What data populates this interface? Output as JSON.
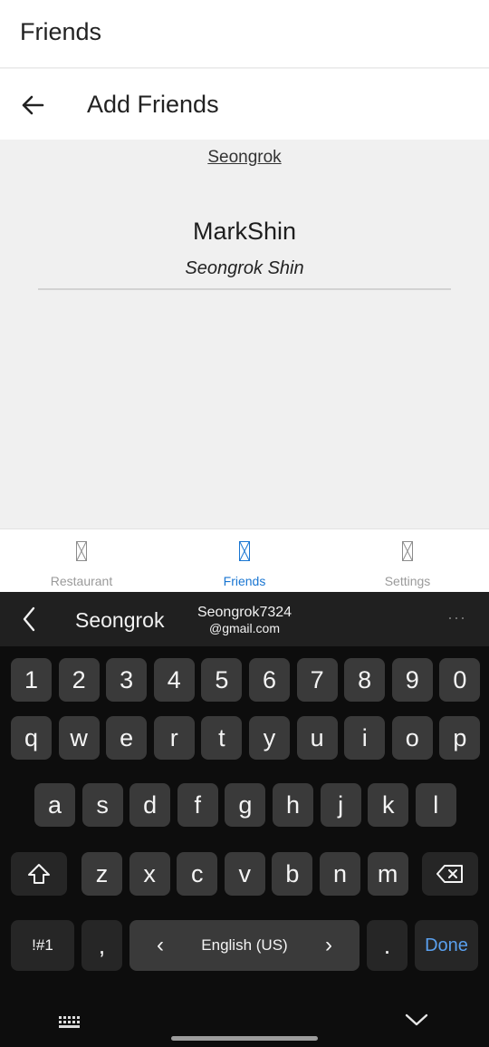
{
  "app": {
    "title": "Friends"
  },
  "screen": {
    "title": "Add Friends"
  },
  "search": {
    "value": "Seongrok"
  },
  "result": {
    "username": "MarkShin",
    "full_name": "Seongrok Shin"
  },
  "nav": {
    "items": [
      {
        "label": "Restaurant",
        "icon": "image-placeholder-icon",
        "active": false
      },
      {
        "label": "Friends",
        "icon": "image-placeholder-icon",
        "active": true
      },
      {
        "label": "Settings",
        "icon": "image-placeholder-icon",
        "active": false
      }
    ],
    "active_color": "#1976d2"
  },
  "keyboard": {
    "suggestions": {
      "first": "Seongrok",
      "second_line1": "Seongrok7324",
      "second_line2": "@gmail.com"
    },
    "more": "···",
    "row_numbers": [
      "1",
      "2",
      "3",
      "4",
      "5",
      "6",
      "7",
      "8",
      "9",
      "0"
    ],
    "row_1": [
      "q",
      "w",
      "e",
      "r",
      "t",
      "y",
      "u",
      "i",
      "o",
      "p"
    ],
    "row_2": [
      "a",
      "s",
      "d",
      "f",
      "g",
      "h",
      "j",
      "k",
      "l"
    ],
    "row_3": [
      "z",
      "x",
      "c",
      "v",
      "b",
      "n",
      "m"
    ],
    "symbols_label": "!#1",
    "comma": ",",
    "language": "English (US)",
    "lang_prev": "‹",
    "lang_next": "›",
    "period": ".",
    "done_label": "Done"
  }
}
